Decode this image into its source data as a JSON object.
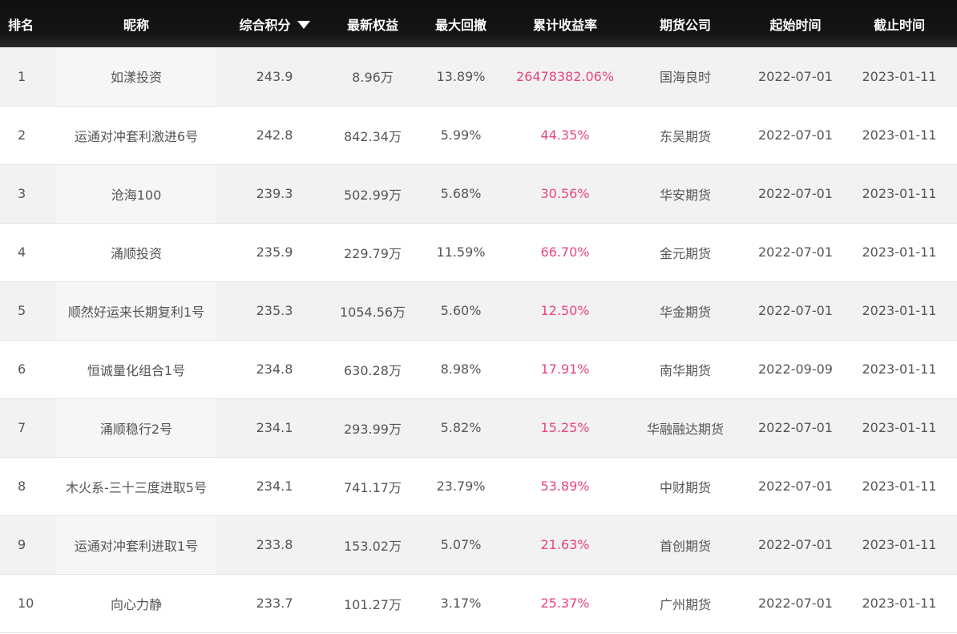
{
  "headers": {
    "rank": "排名",
    "nickname": "昵称",
    "score": "综合积分",
    "equity": "最新权益",
    "drawdown": "最大回撤",
    "return": "累计收益率",
    "company": "期货公司",
    "start": "起始时间",
    "end": "截止时间"
  },
  "sort_icon": "caret-down-icon",
  "colors": {
    "header_bg": "#141414",
    "return_text": "#e8457a",
    "row_alt": "#f2f2f2"
  },
  "rows": [
    {
      "rank": "1",
      "nickname": "如漾投资",
      "score": "243.9",
      "equity": "8.96万",
      "drawdown": "13.89%",
      "return": "26478382.06%",
      "company": "国海良时",
      "start": "2022-07-01",
      "end": "2023-01-11"
    },
    {
      "rank": "2",
      "nickname": "运通对冲套利激进6号",
      "score": "242.8",
      "equity": "842.34万",
      "drawdown": "5.99%",
      "return": "44.35%",
      "company": "东吴期货",
      "start": "2022-07-01",
      "end": "2023-01-11"
    },
    {
      "rank": "3",
      "nickname": "沧海100",
      "score": "239.3",
      "equity": "502.99万",
      "drawdown": "5.68%",
      "return": "30.56%",
      "company": "华安期货",
      "start": "2022-07-01",
      "end": "2023-01-11"
    },
    {
      "rank": "4",
      "nickname": "涌顺投资",
      "score": "235.9",
      "equity": "229.79万",
      "drawdown": "11.59%",
      "return": "66.70%",
      "company": "金元期货",
      "start": "2022-07-01",
      "end": "2023-01-11"
    },
    {
      "rank": "5",
      "nickname": "顺然好运来长期复利1号",
      "score": "235.3",
      "equity": "1054.56万",
      "drawdown": "5.60%",
      "return": "12.50%",
      "company": "华金期货",
      "start": "2022-07-01",
      "end": "2023-01-11"
    },
    {
      "rank": "6",
      "nickname": "恒诚量化组合1号",
      "score": "234.8",
      "equity": "630.28万",
      "drawdown": "8.98%",
      "return": "17.91%",
      "company": "南华期货",
      "start": "2022-09-09",
      "end": "2023-01-11"
    },
    {
      "rank": "7",
      "nickname": "涌顺稳行2号",
      "score": "234.1",
      "equity": "293.99万",
      "drawdown": "5.82%",
      "return": "15.25%",
      "company": "华融融达期货",
      "start": "2022-07-01",
      "end": "2023-01-11"
    },
    {
      "rank": "8",
      "nickname": "木火系-三十三度进取5号",
      "score": "234.1",
      "equity": "741.17万",
      "drawdown": "23.79%",
      "return": "53.89%",
      "company": "中财期货",
      "start": "2022-07-01",
      "end": "2023-01-11"
    },
    {
      "rank": "9",
      "nickname": "运通对冲套利进取1号",
      "score": "233.8",
      "equity": "153.02万",
      "drawdown": "5.07%",
      "return": "21.63%",
      "company": "首创期货",
      "start": "2022-07-01",
      "end": "2023-01-11"
    },
    {
      "rank": "10",
      "nickname": "向心力静",
      "score": "233.7",
      "equity": "101.27万",
      "drawdown": "3.17%",
      "return": "25.37%",
      "company": "广州期货",
      "start": "2022-07-01",
      "end": "2023-01-11"
    }
  ]
}
